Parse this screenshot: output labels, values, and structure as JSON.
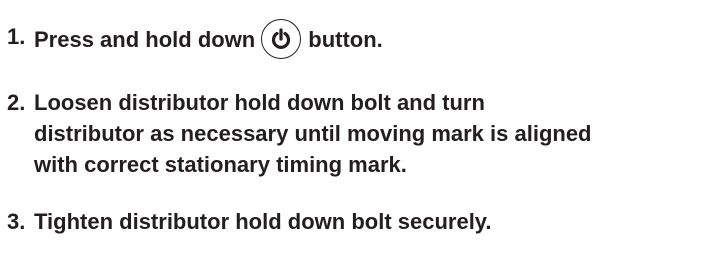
{
  "steps": [
    {
      "number": "1.",
      "text_before": "Press and hold down",
      "icon": "power-icon",
      "text_after": "button."
    },
    {
      "number": "2.",
      "lines": [
        "Loosen distributor hold down bolt and turn",
        "distributor as necessary until moving mark is aligned",
        "with correct stationary timing mark."
      ]
    },
    {
      "number": "3.",
      "lines": [
        "Tighten distributor hold down bolt securely."
      ]
    }
  ]
}
